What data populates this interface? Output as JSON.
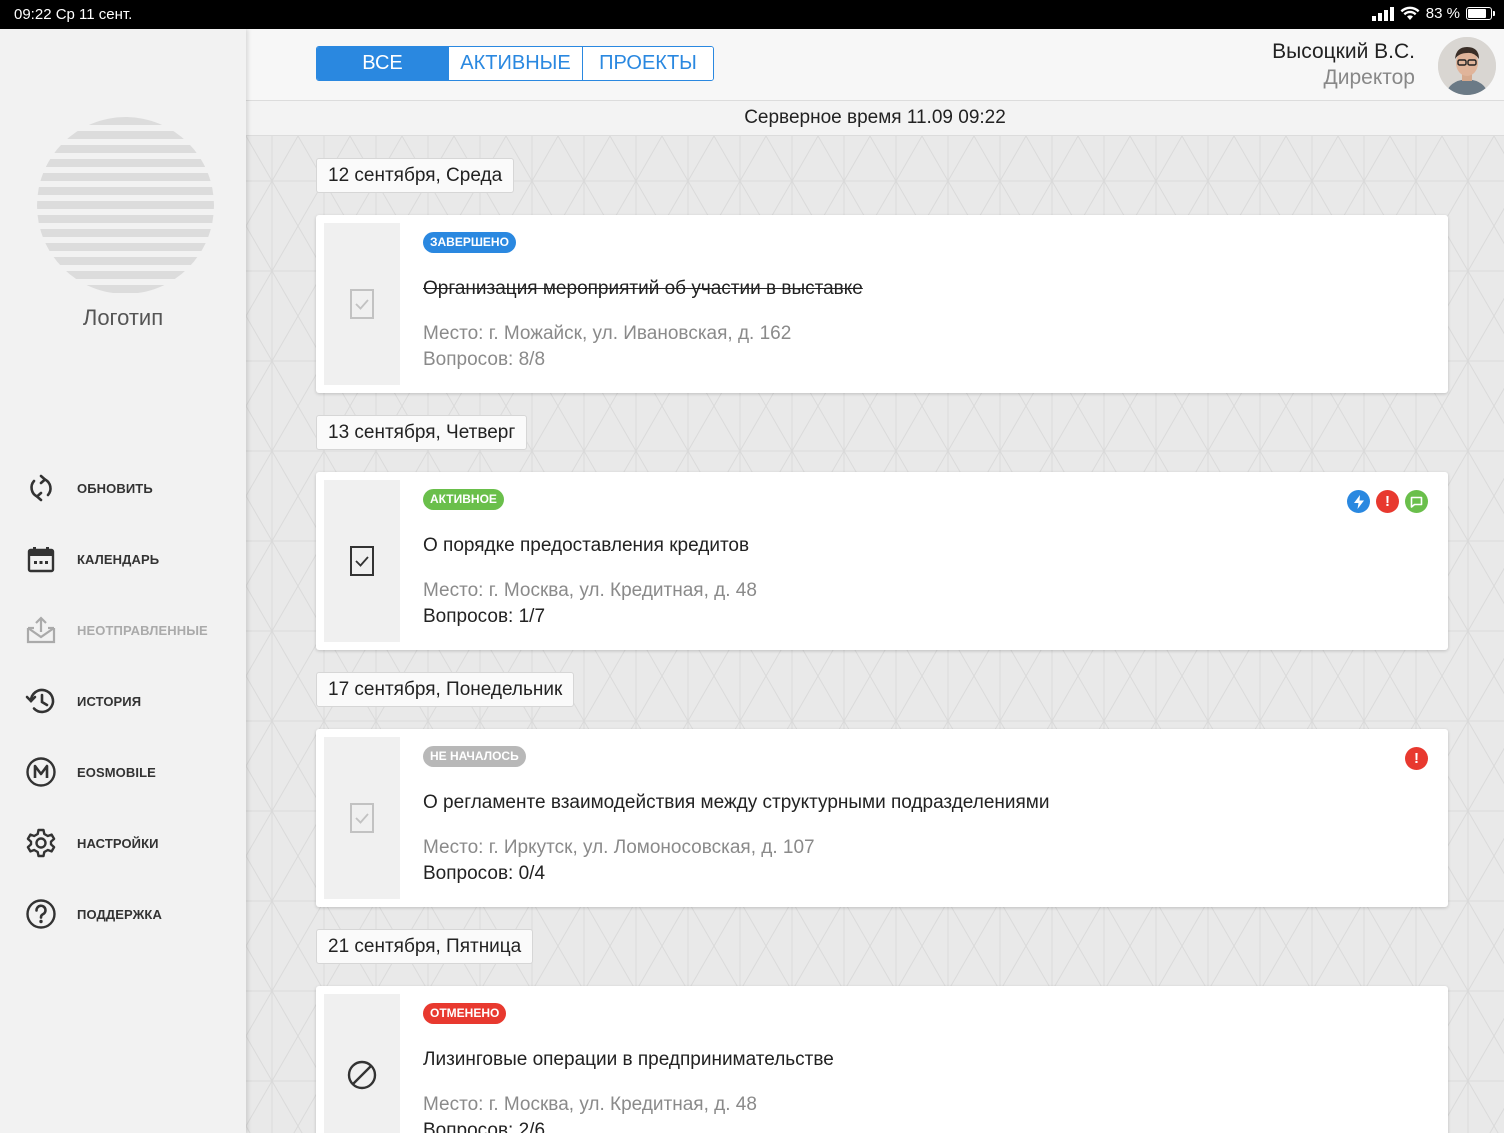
{
  "status_bar": {
    "time_date": "09:22  Ср 11 сент.",
    "battery": "83 %"
  },
  "sidebar": {
    "logo_label": "Логотип",
    "items": [
      {
        "label": "ОБНОВИТЬ",
        "icon": "refresh-icon"
      },
      {
        "label": "КАЛЕНДАРЬ",
        "icon": "calendar-icon"
      },
      {
        "label": "НЕОТПРАВЛЕННЫЕ",
        "icon": "outbox-icon"
      },
      {
        "label": "ИСТОРИЯ",
        "icon": "history-icon"
      },
      {
        "label": "EOSMOBILE",
        "icon": "m-circle-icon"
      },
      {
        "label": "НАСТРОЙКИ",
        "icon": "gear-icon"
      },
      {
        "label": "ПОДДЕРЖКА",
        "icon": "help-icon"
      }
    ]
  },
  "header": {
    "tabs": [
      "ВСЕ",
      "АКТИВНЫЕ",
      "ПРОЕКТЫ"
    ],
    "active_tab": "ВСЕ",
    "user_name": "Высоцкий В.С.",
    "user_role": "Директор"
  },
  "server_time": "Серверное время 11.09 09:22",
  "groups": [
    {
      "date": "12 сентября, Среда",
      "card": {
        "status": "ЗАВЕРШЕНО",
        "status_color": "#2a88e0",
        "title": "Организация мероприятий об участии в выставке",
        "place": "Место: г. Можайск, ул. Ивановская, д. 162",
        "questions": "Вопросов: 8/8",
        "icons": []
      }
    },
    {
      "date": "13 сентября, Четверг",
      "card": {
        "status": "АКТИВНОЕ",
        "status_color": "#6abf4b",
        "title": "О порядке предоставления кредитов",
        "place": "Место: г. Москва, ул. Кредитная, д. 48",
        "questions": "Вопросов: 1/7",
        "icons": [
          "lightning-icon",
          "alert-icon",
          "chat-icon"
        ]
      }
    },
    {
      "date": "17 сентября, Понедельник",
      "card": {
        "status": "НЕ НАЧАЛОСЬ",
        "status_color": "#b8b8b8",
        "title": "О регламенте взаимодействия между структурными подразделениями",
        "place": "Место: г. Иркутск, ул. Ломоносовская, д. 107",
        "questions": "Вопросов: 0/4",
        "icons": [
          "alert-icon"
        ]
      }
    },
    {
      "date": "21 сентября, Пятница",
      "card": {
        "status": "ОТМЕНЕНО",
        "status_color": "#e8392f",
        "title": "Лизинговые операции в предпринимательстве",
        "place": "Место: г. Москва, ул. Кредитная, д. 48",
        "questions": "Вопросов: 2/6",
        "icons": []
      }
    }
  ]
}
